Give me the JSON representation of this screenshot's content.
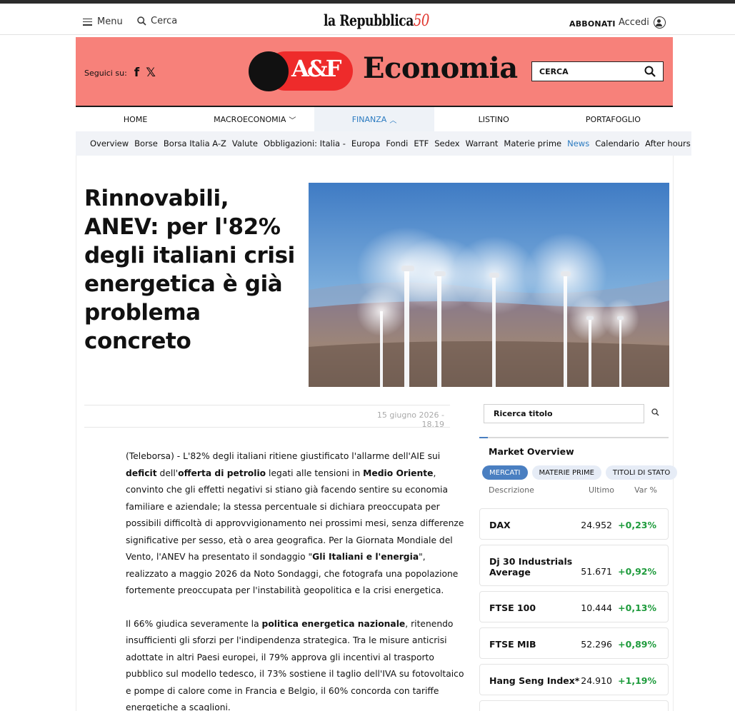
{
  "topbar": {
    "menu_label": "Menu",
    "search_label": "Cerca",
    "brand_name": "la Repubblica",
    "brand_anniversary": "50",
    "subscribe_label": "ABBONATI",
    "login_label": "Accedi"
  },
  "header": {
    "follow_label": "Seguici su:",
    "social_facebook": "f",
    "social_x": "𝕏",
    "logo_text": "A&F",
    "section_title": "Economia",
    "search_label": "CERCA",
    "accent_color": "#f7817a",
    "logo_red": "#ee2b2b"
  },
  "nav": {
    "items": [
      {
        "label": "HOME"
      },
      {
        "label": "MACROECONOMIA"
      },
      {
        "label": "FINANZA"
      },
      {
        "label": "LISTINO"
      },
      {
        "label": "PORTAFOGLIO"
      }
    ],
    "subitems": [
      "Overview",
      "Borse",
      "Borsa Italia A-Z",
      "Valute",
      "Obbligazioni: Italia -",
      "Europa",
      "Fondi",
      "ETF",
      "Sedex",
      "Warrant",
      "Materie prime",
      "News",
      "Calendario",
      "After hours"
    ]
  },
  "article": {
    "headline": "Rinnovabili, ANEV: per l'82% degli italiani crisi energetica è già problema concreto",
    "date": "15 giugno 2026 - 18.19",
    "p1": {
      "t1": "(Teleborsa) - L'82% degli italiani ritiene giustificato l'allarme dell'AIE sui ",
      "b1": "deficit",
      "t2": " dell'",
      "b2": "offerta di petrolio",
      "t3": " legati alle tensioni in ",
      "b3": "Medio Oriente",
      "t4": ", convinto che gli effetti negativi si stiano già facendo sentire su economia familiare e aziendale; la stessa percentuale si dichiara preoccupata per possibili difficoltà di approvvigionamento nei prossimi mesi, senza differenze significative per sesso, età o area geografica. Per la Giornata Mondiale del Vento, l'ANEV ha presentato il sondaggio \"",
      "b4": "Gli Italiani e l'energia",
      "t5": "\", realizzato a maggio 2026 da Noto Sondaggi, che fotografa una popolazione fortemente preoccupata per l'instabilità geopolitica e la crisi energetica."
    },
    "p2": {
      "t1": "Il 66% giudica severamente la ",
      "b1": "politica energetica nazionale",
      "t2": ", ritenendo insufficienti gli sforzi per l'indipendenza strategica. Tra le misure anticrisi adottate in altri Paesi europei, il 79% approva gli incentivi al trasporto pubblico sul modello tedesco, il 73% sostiene il taglio dell'IVA su fotovoltaico e pompe di calore come in Francia e Belgio, il 60% concorda con tariffe energetiche a scaglioni."
    }
  },
  "sidebar": {
    "search_placeholder": "Ricerca titolo",
    "market_title": "Market Overview",
    "tabs": [
      "MERCATI",
      "MATERIE PRIME",
      "TITOLI DI STATO"
    ],
    "col_desc": "Descrizione",
    "col_last": "Ultimo",
    "col_var": "Var %",
    "rows": [
      {
        "name": "DAX",
        "last": "24.952",
        "var": "+0,23%"
      },
      {
        "name": "Dj 30 Industrials Average",
        "last": "51.671",
        "var": "+0,92%"
      },
      {
        "name": "FTSE 100",
        "last": "10.444",
        "var": "+0,13%"
      },
      {
        "name": "FTSE MIB",
        "last": "52.296",
        "var": "+0,89%"
      },
      {
        "name": "Hang Seng Index*",
        "last": "24.910",
        "var": "+1,19%"
      }
    ],
    "positive_color": "#1e9b3c"
  }
}
